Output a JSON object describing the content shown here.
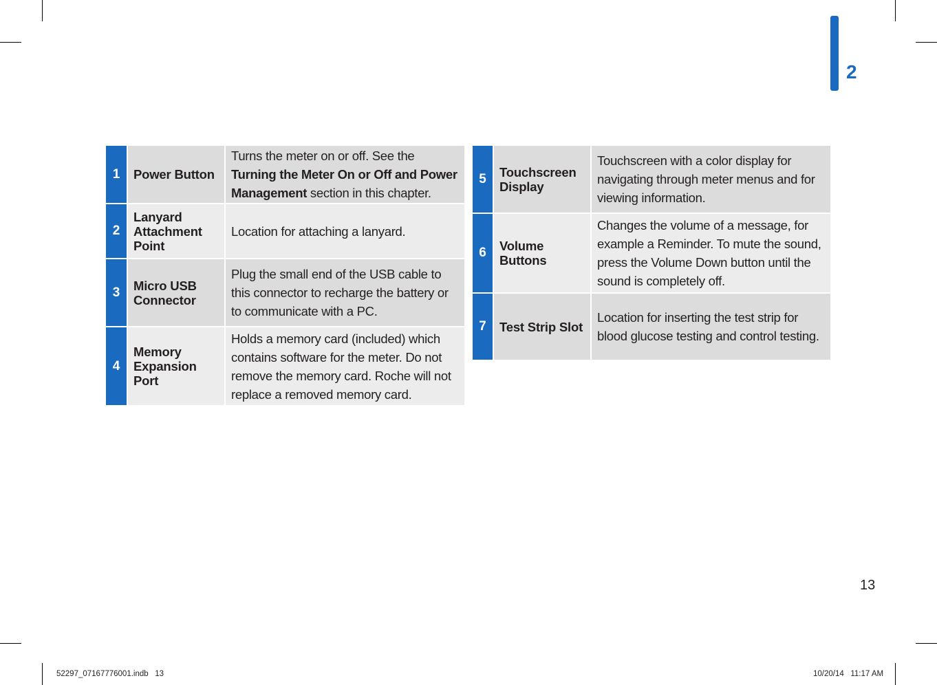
{
  "colors": {
    "accent_blue": "#1a6bc0",
    "row_dark": "#dcdcdc",
    "row_light": "#ececec"
  },
  "chapter_tab": {
    "number": "2"
  },
  "page_number": "13",
  "slug": {
    "file": "52297_07167776001.indb   13",
    "date_time": "10/20/14   11:17 AM"
  },
  "left_table": {
    "rows": [
      {
        "number": "1",
        "name": "Power Button",
        "desc_pre": "Turns the meter on or off. See the ",
        "desc_bold": "Turning the Meter On or Off and Power Management",
        "desc_post": " section in this chapter."
      },
      {
        "number": "2",
        "name": "Lanyard Attachment Point",
        "description": "Location for attaching a lanyard."
      },
      {
        "number": "3",
        "name": "Micro USB Connector",
        "description": "Plug the small end of the USB cable to this connector to recharge the battery or to communicate with a PC."
      },
      {
        "number": "4",
        "name": "Memory Expansion Port",
        "description": "Holds a memory card (included) which contains software for the meter. Do not remove the memory card. Roche will not replace a removed memory card."
      }
    ]
  },
  "right_table": {
    "rows": [
      {
        "number": "5",
        "name": "Touchscreen Display",
        "description": "Touchscreen with a color display for navigating through meter menus and for viewing information."
      },
      {
        "number": "6",
        "name": "Volume Buttons",
        "description": "Changes the volume of a message, for example a Reminder. To mute the sound, press the Volume Down button until the sound is completely off."
      },
      {
        "number": "7",
        "name": "Test Strip Slot",
        "description": "Location for inserting the test strip for blood glucose testing and control testing."
      }
    ]
  }
}
